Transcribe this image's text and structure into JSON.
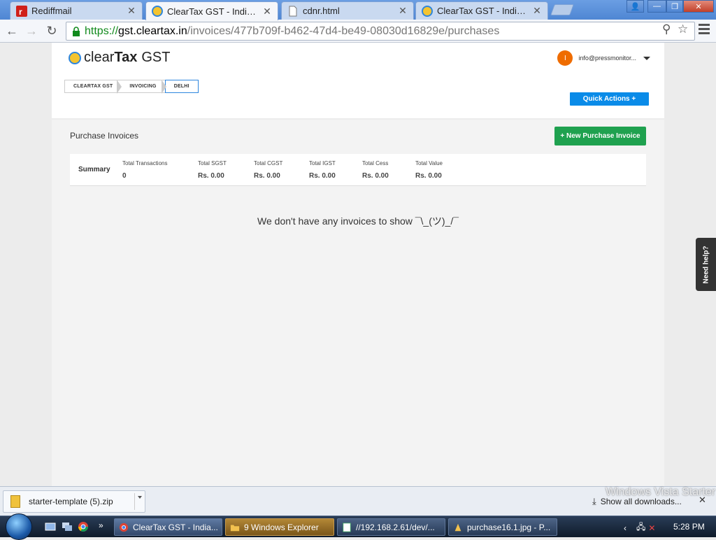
{
  "browser": {
    "tabs": [
      {
        "title": "Rediffmail",
        "active": false
      },
      {
        "title": "ClearTax GST - India's first",
        "active": true
      },
      {
        "title": "cdnr.html",
        "active": false
      },
      {
        "title": "ClearTax GST - India's first",
        "active": false
      }
    ],
    "url": {
      "secure": "https://",
      "host": "gst.cleartax.in",
      "path": "/invoices/477b709f-b462-47d4-be49-08030d16829e/purchases"
    }
  },
  "header": {
    "logo_brand_light": "clear",
    "logo_brand_bold": "Tax",
    "logo_product": "GST",
    "breadcrumbs": [
      "CLEARTAX GST",
      "INVOICING",
      "DELHI"
    ],
    "user_initial": "I",
    "user_email": "info@pressmonitor...",
    "quick_actions_label": "Quick Actions +"
  },
  "main": {
    "title": "Purchase Invoices",
    "new_invoice_label": "+ New Purchase Invoice",
    "summary": {
      "label": "Summary",
      "stats": [
        {
          "key": "Total Transactions",
          "value": "0"
        },
        {
          "key": "Total SGST",
          "value": "Rs. 0.00"
        },
        {
          "key": "Total CGST",
          "value": "Rs. 0.00"
        },
        {
          "key": "Total IGST",
          "value": "Rs. 0.00"
        },
        {
          "key": "Total Cess",
          "value": "Rs. 0.00"
        },
        {
          "key": "Total Value",
          "value": "Rs. 0.00"
        }
      ]
    },
    "empty_message": "We don't have any invoices to show ¯\\_(ツ)_/¯"
  },
  "help_tab_label": "Need help?",
  "downloads": {
    "item_name": "starter-template (5).zip",
    "show_all_label": "Show all downloads..."
  },
  "watermark": "Windows Vista Starter",
  "taskbar": {
    "tasks": [
      {
        "label": "ClearTax GST - India..."
      },
      {
        "label": "9 Windows Explorer"
      },
      {
        "label": "//192.168.2.61/dev/..."
      },
      {
        "label": "purchase16.1.jpg - P..."
      }
    ],
    "clock": "5:28 PM"
  },
  "colors": {
    "accent_blue": "#0a8be8",
    "accent_green": "#1fa14f",
    "avatar_orange": "#ef6c00"
  }
}
